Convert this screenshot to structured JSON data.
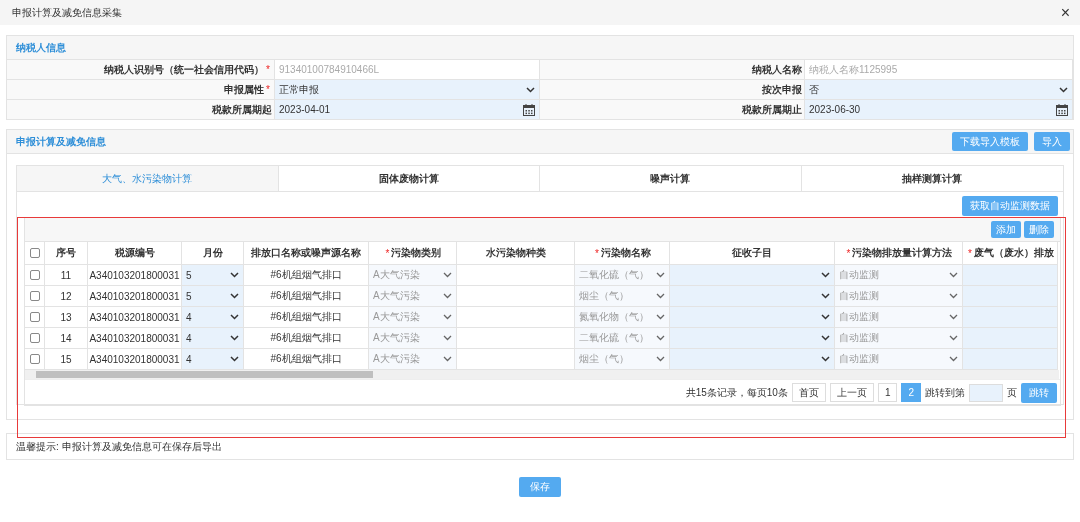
{
  "window": {
    "title": "申报计算及减免信息采集",
    "close": "×"
  },
  "taxpayer": {
    "title": "纳税人信息",
    "fields": [
      {
        "label": "纳税人识别号（统一社会信用代码）",
        "mark": "*",
        "kind": "text",
        "value": "91340100784910466L"
      },
      {
        "label": "纳税人名称",
        "kind": "text",
        "value": "纳税人名称1125995"
      },
      {
        "label": "申报属性",
        "mark": "*",
        "kind": "select",
        "value": "正常申报"
      },
      {
        "label": "按次申报",
        "kind": "select",
        "value": "否"
      },
      {
        "label": "税款所属期起",
        "kind": "date",
        "value": "2023-04-01"
      },
      {
        "label": "税款所属期止",
        "kind": "date",
        "value": "2023-06-30"
      }
    ]
  },
  "calc": {
    "title": "申报计算及减免信息",
    "buttons": [
      "下载导入模板",
      "导入"
    ],
    "tabs": [
      {
        "label": "大气、水污染物计算",
        "selected": true
      },
      {
        "label": "固体废物计算",
        "selected": false
      },
      {
        "label": "噪声计算",
        "selected": false
      },
      {
        "label": "抽样测算计算",
        "selected": false
      }
    ],
    "fetch_button": "获取自动监测数据",
    "all_checked": false,
    "table_buttons": [
      "添加",
      "删除"
    ],
    "columns": [
      {
        "label": "序号"
      },
      {
        "label": "税源编号"
      },
      {
        "label": "月份"
      },
      {
        "label": "排放口名称或噪声源名称"
      },
      {
        "label": "污染物类别",
        "mark": "*"
      },
      {
        "label": "水污染物种类"
      },
      {
        "label": "污染物名称",
        "mark": "*"
      },
      {
        "label": "征收子目"
      },
      {
        "label": "污染物排放量计算方法",
        "mark": "*"
      },
      {
        "label": "废气（废水）排放",
        "mark": "*"
      }
    ],
    "rows": [
      {
        "checked": false,
        "seq": "11",
        "source": "A340103201800031",
        "month": "5",
        "outlet": "#6机组烟气排口",
        "category": "A大气污染",
        "pollutant": "二氧化硫（气）",
        "method": "自动监测"
      },
      {
        "checked": false,
        "seq": "12",
        "source": "A340103201800031",
        "month": "5",
        "outlet": "#6机组烟气排口",
        "category": "A大气污染",
        "pollutant": "烟尘（气）",
        "method": "自动监测"
      },
      {
        "checked": false,
        "seq": "13",
        "source": "A340103201800031",
        "month": "4",
        "outlet": "#6机组烟气排口",
        "category": "A大气污染",
        "pollutant": "氮氧化物（气）",
        "method": "自动监测"
      },
      {
        "checked": false,
        "seq": "14",
        "source": "A340103201800031",
        "month": "4",
        "outlet": "#6机组烟气排口",
        "category": "A大气污染",
        "pollutant": "二氧化硫（气）",
        "method": "自动监测"
      },
      {
        "checked": false,
        "seq": "15",
        "source": "A340103201800031",
        "month": "4",
        "outlet": "#6机组烟气排口",
        "category": "A大气污染",
        "pollutant": "烟尘（气）",
        "method": "自动监测"
      }
    ],
    "pagination": {
      "summary": "共15条记录，每页10条",
      "first": "首页",
      "prev": "上一页",
      "pages": [
        {
          "label": "1",
          "selected": false
        },
        {
          "label": "2",
          "selected": true
        }
      ],
      "jump_label": "跳转到第",
      "unit": "页",
      "jump_button": "跳转"
    }
  },
  "notice": "温馨提示: 申报计算及减免信息可在保存后导出",
  "save_button": "保存"
}
